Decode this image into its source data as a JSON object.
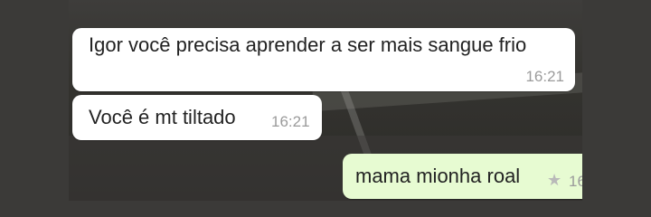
{
  "messages": [
    {
      "direction": "incoming",
      "text": "Igor você precisa aprender a ser mais sangue frio",
      "time": "16:21"
    },
    {
      "direction": "incoming",
      "text": "Você é mt tiltado",
      "time": "16:21"
    },
    {
      "direction": "outgoing",
      "text": "mama mionha roal",
      "time": "16",
      "starred": true,
      "star_icon": "star-icon"
    }
  ],
  "colors": {
    "outer_background": "#3b3a38",
    "incoming_bubble": "#ffffff",
    "outgoing_bubble": "#e7fbd2",
    "timestamp": "#9b9b9b"
  }
}
